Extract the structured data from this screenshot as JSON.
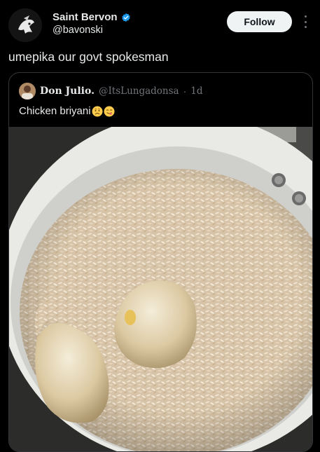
{
  "author": {
    "display_name": "Saint Bervon",
    "handle": "@bavonski",
    "verified": true
  },
  "actions": {
    "follow_label": "Follow"
  },
  "post": {
    "text": "umepika our govt spokesman"
  },
  "quote": {
    "display_name": "Don Julio.",
    "handle": "@ItsLungadonsa",
    "separator": "·",
    "time": "1d",
    "text": "Chicken briyani",
    "emojis": [
      "worried-face",
      "face-savoring-food"
    ]
  },
  "colors": {
    "background": "#000000",
    "text": "#e7e9ea",
    "muted": "#71767b",
    "verified_blue": "#1d9bf0",
    "follow_bg": "#eff3f4",
    "border": "#333639"
  }
}
